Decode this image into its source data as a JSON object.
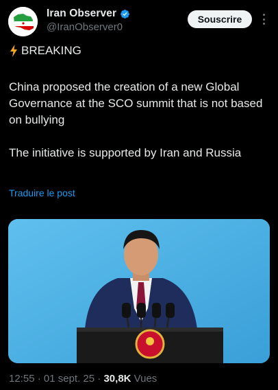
{
  "author": {
    "display_name": "Iran Observer",
    "handle": "@IranObserver0",
    "avatar_icon": "iran-map-flag-avatar",
    "verified_icon": "verified-badge-icon"
  },
  "actions": {
    "subscribe_label": "Souscrire",
    "more_icon": "more-vertical-icon"
  },
  "post": {
    "breaking_label": "BREAKING",
    "breaking_icon": "lightning-bolt-icon",
    "paragraph_1": "China proposed the creation of a new Global Governance at the SCO summit that is not based on bullying",
    "paragraph_2": "The initiative is supported by Iran and Russia",
    "translate_label": "Traduire le post"
  },
  "media": {
    "description_icon": "speaker-at-podium-photo"
  },
  "meta": {
    "time": "12:55",
    "date": "01 sept. 25",
    "separator": "·",
    "views_count": "30,8K",
    "views_label": "Vues"
  },
  "colors": {
    "background": "#000000",
    "text": "#e7e9ea",
    "secondary": "#71767b",
    "link": "#1d9bf0",
    "verified": "#1d9bf0",
    "button_bg": "#eff3f4"
  }
}
